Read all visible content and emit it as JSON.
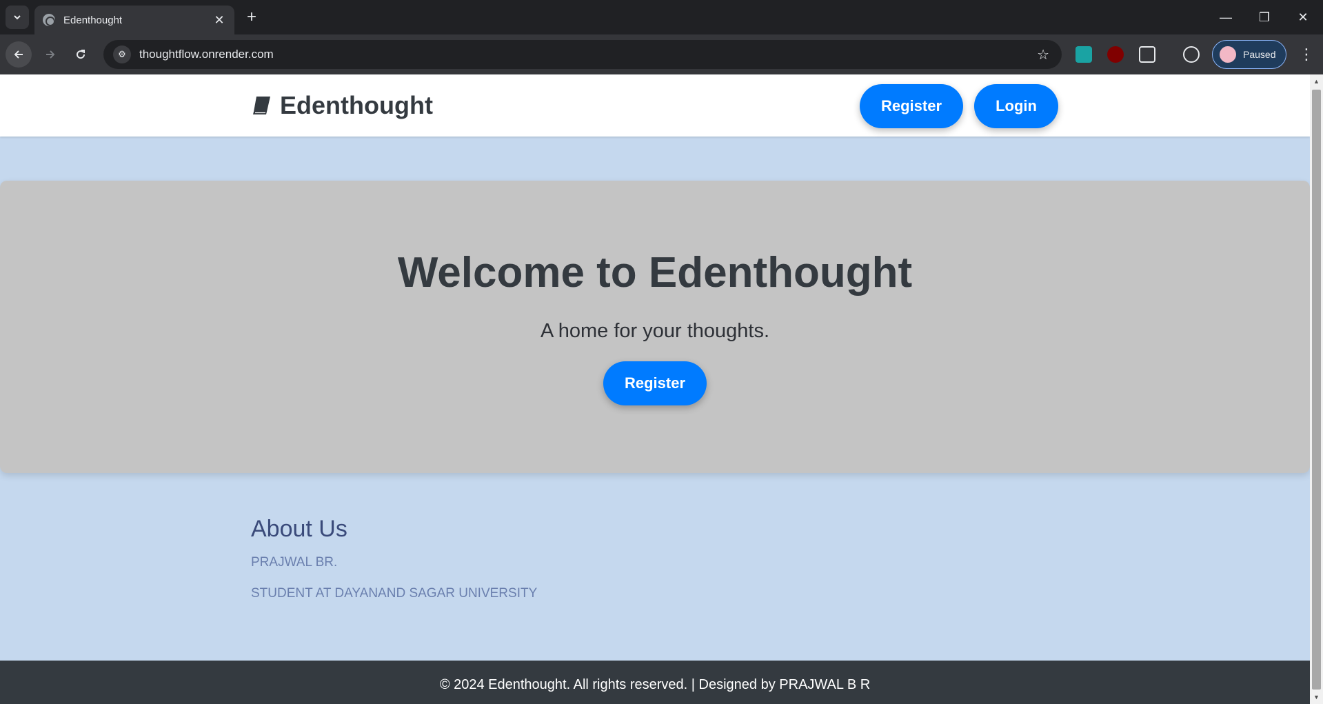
{
  "browser": {
    "tab_title": "Edenthought",
    "tab_close": "✕",
    "new_tab": "+",
    "url": "thoughtflow.onrender.com",
    "profile_label": "Paused",
    "window_controls": {
      "minimize": "—",
      "restore": "❐",
      "close": "✕"
    }
  },
  "site": {
    "brand": "Edenthought",
    "nav": {
      "register": "Register",
      "login": "Login"
    },
    "hero": {
      "title": "Welcome to Edenthought",
      "subtitle": "A home for your thoughts.",
      "cta": "Register"
    },
    "about": {
      "heading": "About Us",
      "lines": [
        "PRAJWAL BR.",
        "STUDENT AT DAYANAND SAGAR UNIVERSITY"
      ]
    },
    "footer": "© 2024 Edenthought. All rights reserved. | Designed by PRAJWAL B R"
  },
  "colors": {
    "accent": "#007bff",
    "page_bg": "#c5d8ee",
    "hero_bg": "#c4c4c4",
    "footer_bg": "#343a40"
  },
  "icons": [
    "tab-search-icon",
    "globe-icon",
    "back-icon",
    "forward-icon",
    "reload-icon",
    "site-info-icon",
    "star-icon",
    "extension-icon",
    "book-icon",
    "menu-icon"
  ]
}
